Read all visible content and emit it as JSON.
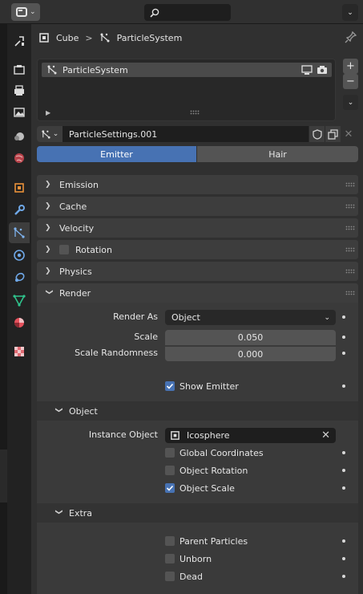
{
  "header": {
    "editor_icon": "properties-editor-icon",
    "search_icon": "search-icon"
  },
  "breadcrumb": {
    "object": "Cube",
    "system": "ParticleSystem",
    "separator": ">"
  },
  "particle_list": {
    "items": [
      {
        "label": "ParticleSystem",
        "icons": [
          "monitor-icon",
          "camera-icon"
        ]
      }
    ],
    "buttons": [
      "+",
      "−"
    ]
  },
  "settings": {
    "name": "ParticleSettings.001"
  },
  "type_toggle": {
    "options": [
      "Emitter",
      "Hair"
    ],
    "selected": "Emitter"
  },
  "panels": {
    "emission": "Emission",
    "cache": "Cache",
    "velocity": "Velocity",
    "rotation": "Rotation",
    "physics": "Physics",
    "render": "Render"
  },
  "render": {
    "render_as_label": "Render As",
    "render_as_value": "Object",
    "scale_label": "Scale",
    "scale_value": "0.050",
    "scale_rand_label": "Scale Randomness",
    "scale_rand_value": "0.000",
    "show_emitter_label": "Show Emitter",
    "show_emitter_checked": true
  },
  "object_sub": {
    "title": "Object",
    "instance_label": "Instance Object",
    "instance_value": "Icosphere",
    "global_coords": "Global Coordinates",
    "global_coords_checked": false,
    "object_rotation": "Object Rotation",
    "object_rotation_checked": false,
    "object_scale": "Object Scale",
    "object_scale_checked": true
  },
  "extra_sub": {
    "title": "Extra",
    "parent_particles": "Parent Particles",
    "unborn": "Unborn",
    "dead": "Dead"
  },
  "colors": {
    "accent": "#4772b3",
    "panel": "#3d3d3d",
    "background": "#303030"
  }
}
